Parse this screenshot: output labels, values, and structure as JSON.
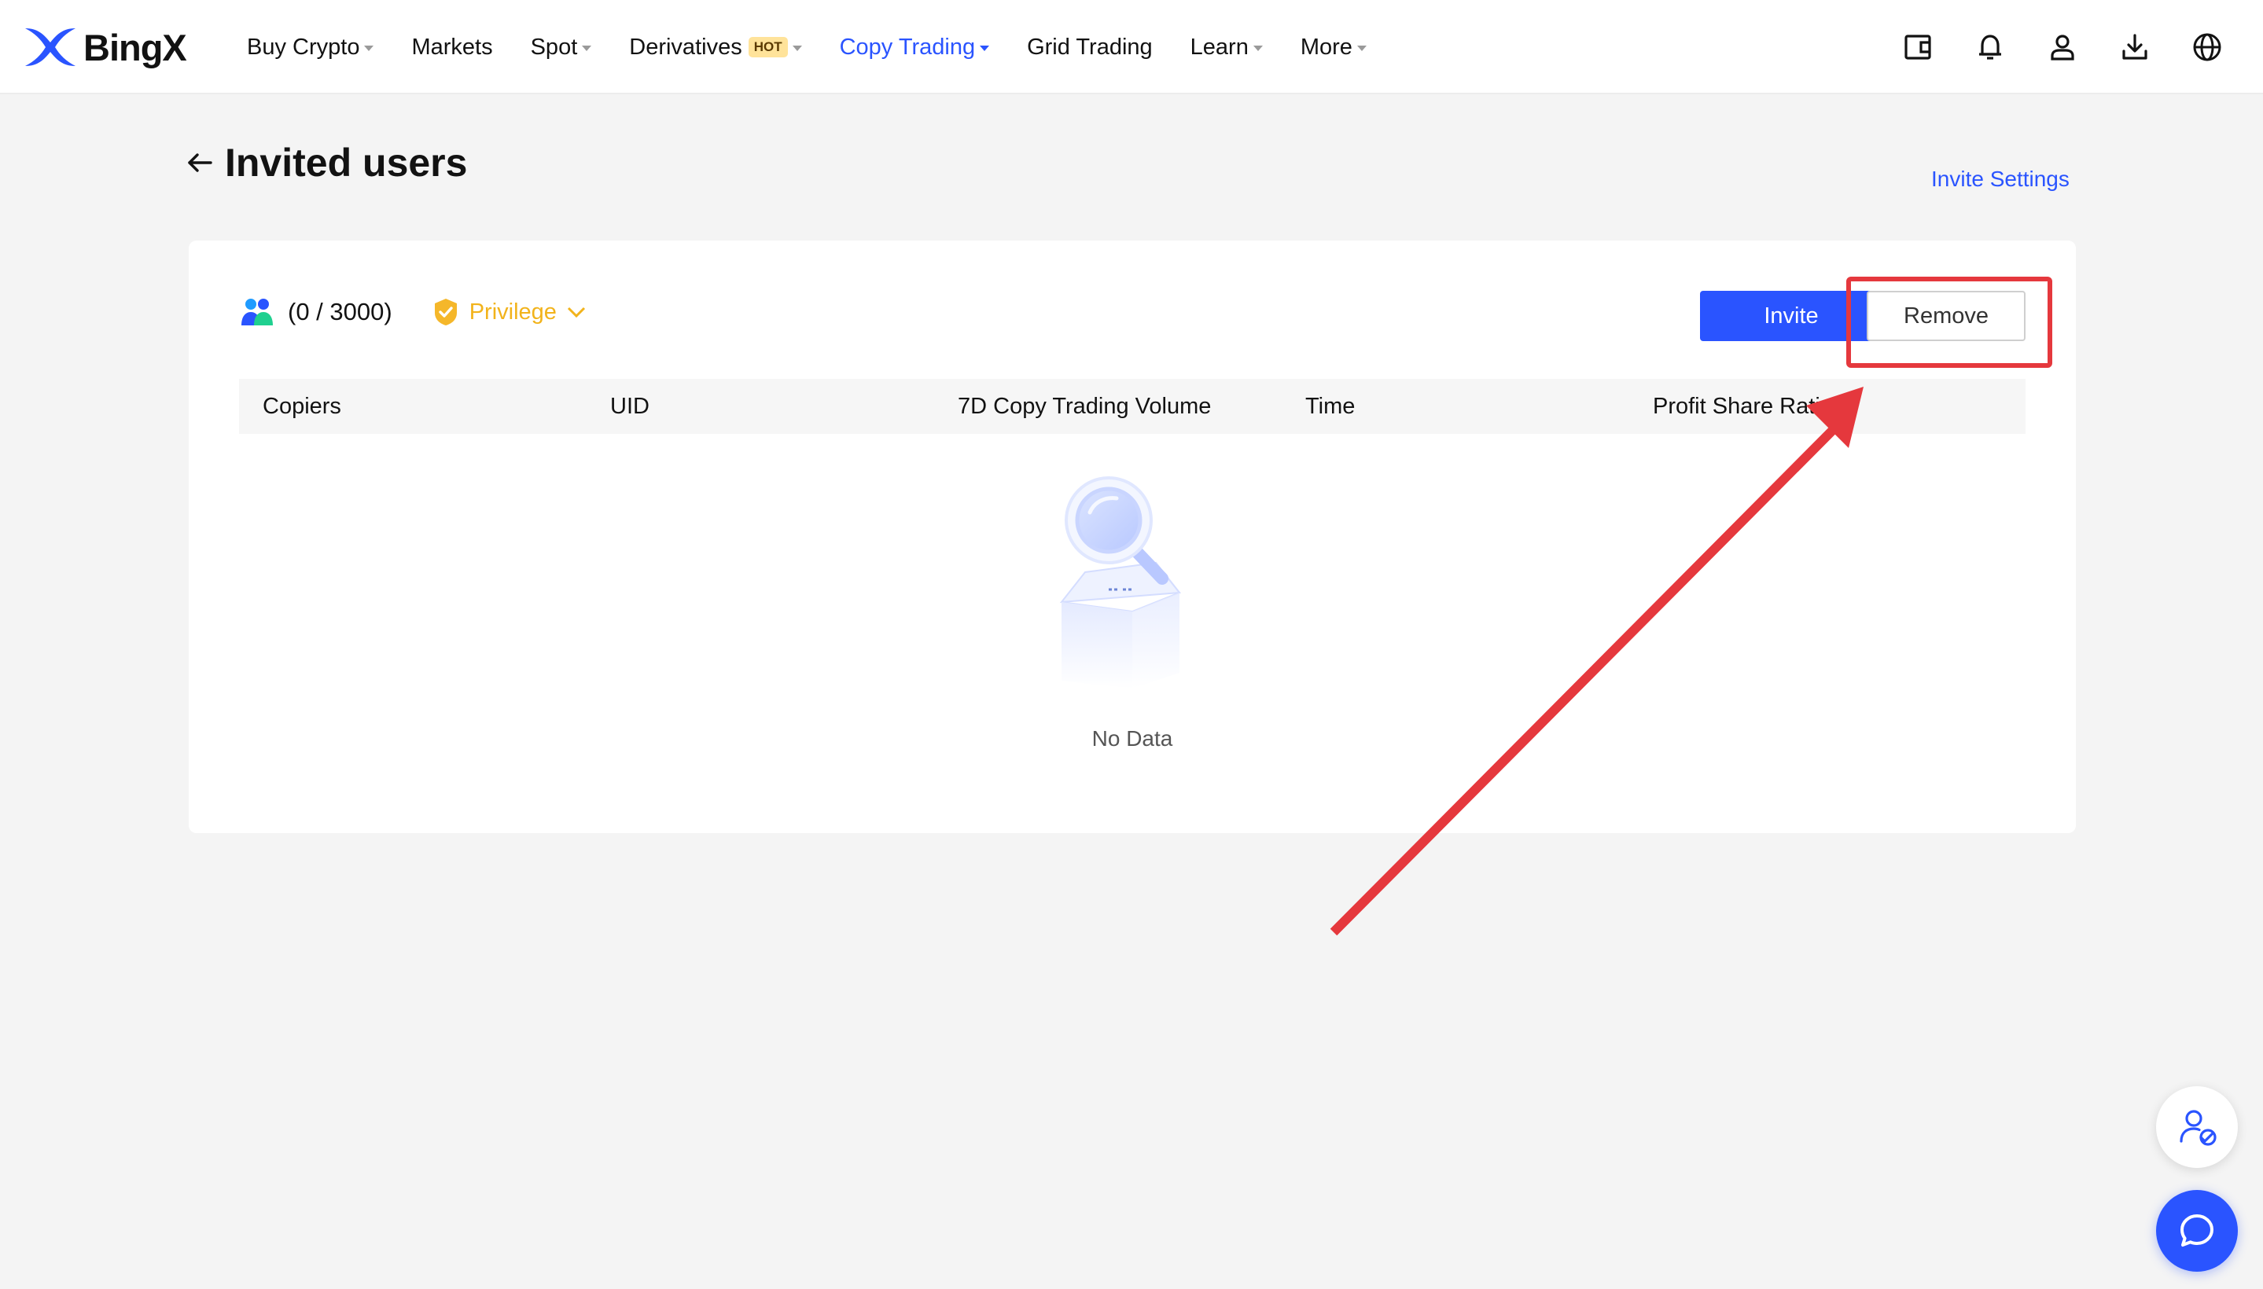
{
  "brand": {
    "name": "BingX",
    "color": "#2a54ff"
  },
  "nav": {
    "items": [
      {
        "label": "Buy Crypto",
        "caret": true
      },
      {
        "label": "Markets",
        "caret": false
      },
      {
        "label": "Spot",
        "caret": true
      },
      {
        "label": "Derivatives",
        "badge": "HOT",
        "caret": true
      },
      {
        "label": "Copy Trading",
        "caret": true,
        "active": true
      },
      {
        "label": "Grid Trading",
        "caret": false
      },
      {
        "label": "Learn",
        "caret": true
      },
      {
        "label": "More",
        "caret": true
      }
    ],
    "icons": [
      "wallet-icon",
      "bell-icon",
      "user-icon",
      "download-icon",
      "globe-icon"
    ]
  },
  "page": {
    "title": "Invited users",
    "invite_settings": "Invite Settings"
  },
  "card": {
    "count": "(0 / 3000)",
    "privilege": "Privilege",
    "invite_button": "Invite",
    "remove_button": "Remove"
  },
  "table": {
    "columns": [
      "Copiers",
      "UID",
      "7D Copy Trading Volume",
      "Time",
      "Profit Share Rati"
    ],
    "rows": [],
    "empty_text": "No Data"
  },
  "colors": {
    "accent": "#2a54ff",
    "privilege": "#f2b31b",
    "annotation": "#e5383d"
  }
}
